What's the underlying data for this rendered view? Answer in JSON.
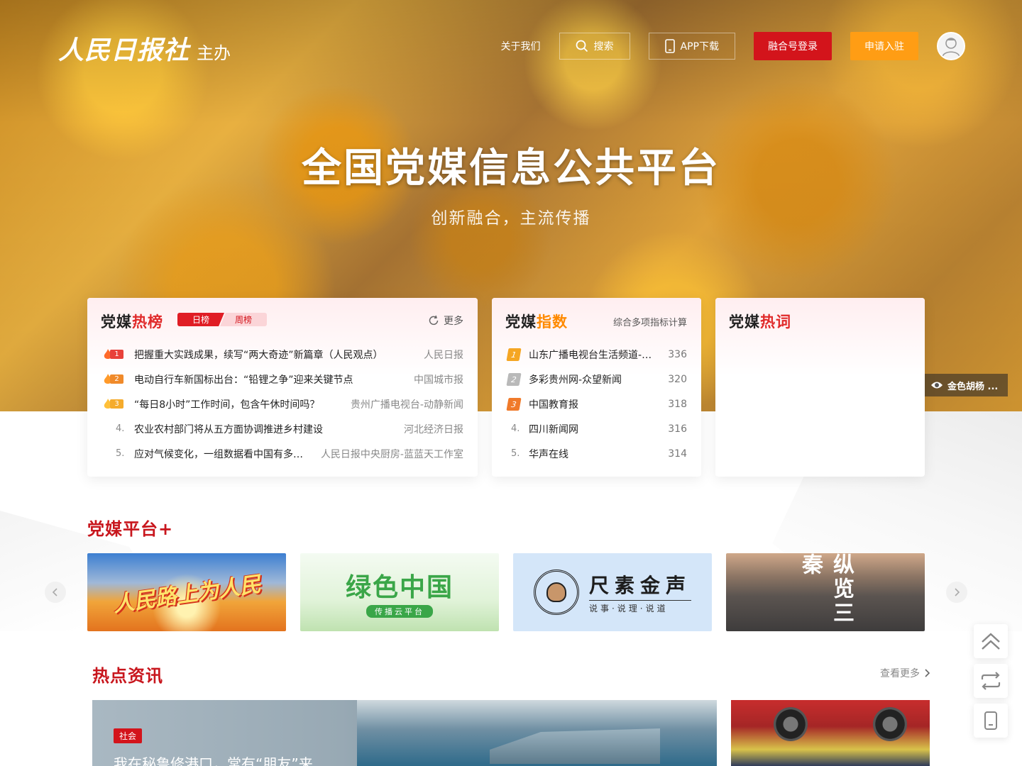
{
  "header": {
    "logo_brand": "人民日报社",
    "logo_host": "主办",
    "about": "关于我们",
    "search": "搜索",
    "app_download": "APP下载",
    "login": "融合号登录",
    "apply": "申请入驻"
  },
  "hero": {
    "title": "全国党媒信息公共平台",
    "subtitle": "创新融合，主流传播",
    "caption": "金色胡杨 ..."
  },
  "hot_rank": {
    "title_prefix": "党媒",
    "title_accent": "热榜",
    "tab_day": "日榜",
    "tab_week": "周榜",
    "more": "更多",
    "items": [
      {
        "rank": "1",
        "text": "把握重大实践成果，续写“两大奇迹”新篇章（人民观点）",
        "source": "人民日报"
      },
      {
        "rank": "2",
        "text": "电动自行车新国标出台：“铅锂之争”迎来关键节点",
        "source": "中国城市报"
      },
      {
        "rank": "3",
        "text": "“每日8小时”工作时间，包含午休时间吗？",
        "source": "贵州广播电视台-动静新闻"
      },
      {
        "rank": "4.",
        "text": "农业农村部门将从五方面协调推进乡村建设",
        "source": "河北经济日报"
      },
      {
        "rank": "5.",
        "text": "应对气候变化，一组数据看中国有多努力",
        "source": "人民日报中央厨房-蓝蓝天工作室"
      }
    ]
  },
  "index_rank": {
    "title_prefix": "党媒",
    "title_accent": "指数",
    "note": "综合多项指标计算",
    "items": [
      {
        "rank": "1",
        "name": "山东广播电视台生活频道-生...",
        "score": "336"
      },
      {
        "rank": "2",
        "name": "多彩贵州网-众望新闻",
        "score": "320"
      },
      {
        "rank": "3",
        "name": "中国教育报",
        "score": "318"
      },
      {
        "rank": "4.",
        "name": "四川新闻网",
        "score": "316"
      },
      {
        "rank": "5.",
        "name": "华声在线",
        "score": "314"
      }
    ]
  },
  "hot_words": {
    "title_prefix": "党媒",
    "title_accent": "热词"
  },
  "platform": {
    "title": "党媒平台+",
    "banners": [
      {
        "title": "人民路上为人民"
      },
      {
        "title": "绿色中国",
        "subtitle": "传播云平台"
      },
      {
        "title": "尺素金声",
        "subtitle": "说事·说理·说道"
      },
      {
        "title": "纵览三秦"
      }
    ]
  },
  "news": {
    "title": "热点资讯",
    "see_more": "查看更多",
    "main": {
      "tag": "社会",
      "headline": "我在秘鲁修港口，常有“朋友”来"
    }
  },
  "colors": {
    "brand_red": "#d3141b",
    "accent_orange": "#ff9d14",
    "rank1": "#e8413a",
    "rank2": "#f08a2a",
    "rank3": "#f5ab2c"
  }
}
